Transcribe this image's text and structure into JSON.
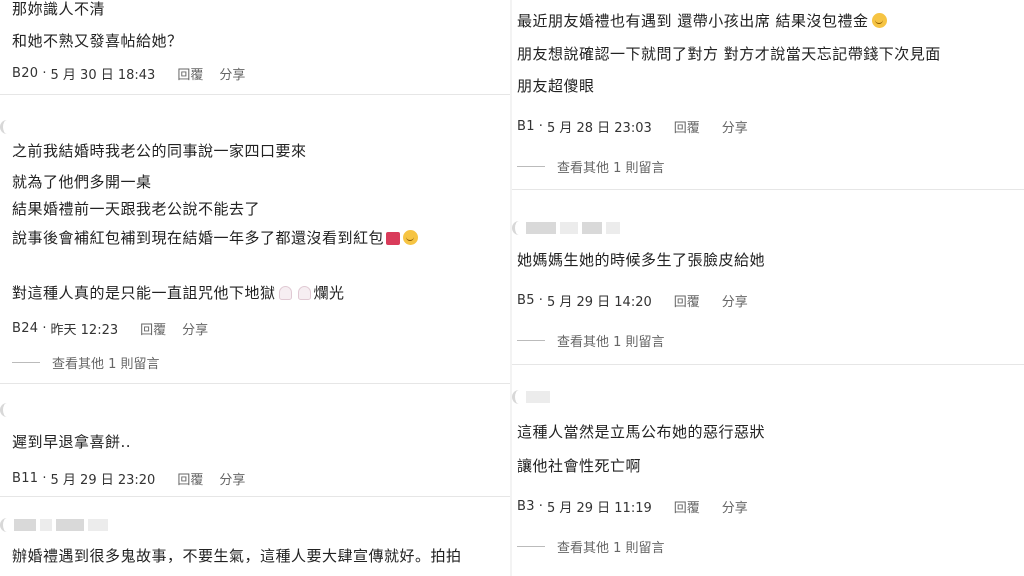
{
  "left": {
    "c1": {
      "lines": [
        "那妳識人不清",
        "和她不熟又發喜帖給她？"
      ],
      "floor": "B20",
      "time": "5 月 30 日 18:43",
      "reply": "回覆",
      "share": "分享"
    },
    "c2": {
      "lines": [
        "之前我結婚時我老公的同事說一家四口要來",
        "就為了他們多開一桌",
        "結果婚禮前一天跟我老公說不能去了",
        "說事後會補紅包補到現在結婚一年多了都還沒看到紅包",
        "對這種人真的是只能一直詛咒他下地獄",
        "爛光"
      ],
      "floor": "B24",
      "time": "昨天 12:23",
      "reply": "回覆",
      "share": "分享",
      "more": "查看其他 1 則留言"
    },
    "c3": {
      "lines": [
        "遲到早退拿喜餅.."
      ],
      "floor": "B11",
      "time": "5 月 29 日 23:20",
      "reply": "回覆",
      "share": "分享"
    },
    "c4": {
      "lines": [
        "辦婚禮遇到很多鬼故事，不要生氣，這種人要大肆宣傳就好。拍拍"
      ]
    }
  },
  "right": {
    "c1": {
      "lines": [
        "最近朋友婚禮也有遇到 還帶小孩出席 結果沒包禮金",
        "朋友想說確認一下就問了對方 對方才說當天忘記帶錢下次見面",
        "朋友超傻眼"
      ],
      "floor": "B1",
      "time": "5 月 28 日 23:03",
      "reply": "回覆",
      "share": "分享",
      "more": "查看其他 1 則留言"
    },
    "c2": {
      "lines": [
        "她媽媽生她的時候多生了張臉皮給她"
      ],
      "floor": "B5",
      "time": "5 月 29 日 14:20",
      "reply": "回覆",
      "share": "分享",
      "more": "查看其他 1 則留言"
    },
    "c3": {
      "lines": [
        "這種人當然是立馬公布她的惡行惡狀",
        "讓他社會性死亡啊"
      ],
      "floor": "B3",
      "time": "5 月 29 日 11:19",
      "reply": "回覆",
      "share": "分享",
      "more": "查看其他 1 則留言"
    }
  },
  "meta_separator": "·"
}
